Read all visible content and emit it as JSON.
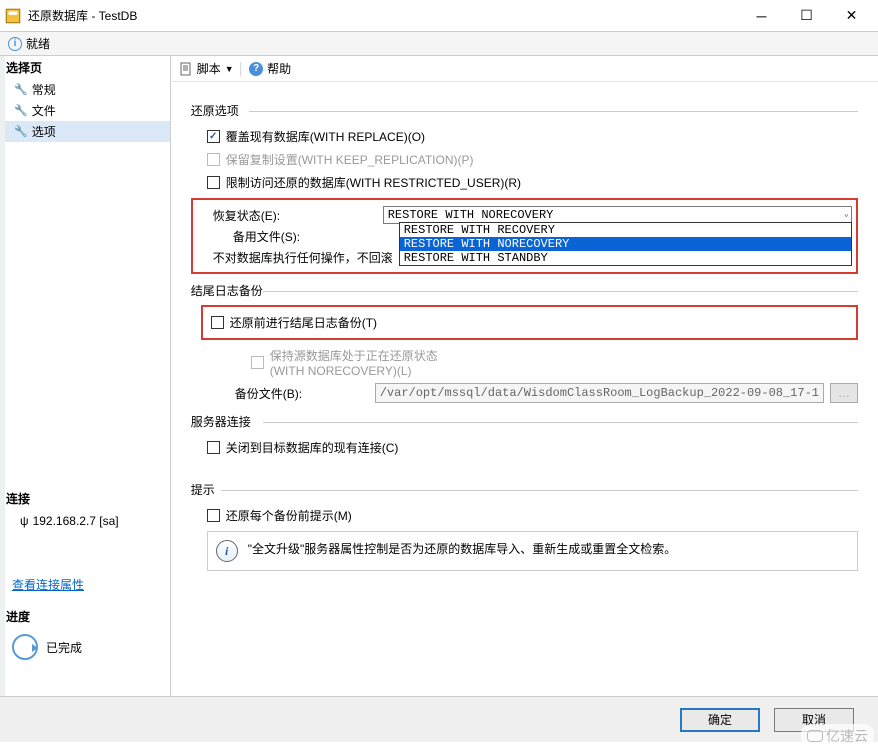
{
  "window": {
    "title": "还原数据库 - TestDB",
    "status": "就绪"
  },
  "sidebar": {
    "select_page_header": "选择页",
    "items": [
      {
        "label": "常规"
      },
      {
        "label": "文件"
      },
      {
        "label": "选项"
      }
    ],
    "connection_header": "连接",
    "connection_value": "192.168.2.7 [sa]",
    "view_link": "查看连接属性",
    "progress_header": "进度",
    "progress_status": "已完成"
  },
  "toolbar": {
    "script": "脚本",
    "help": "帮助"
  },
  "restore_options": {
    "title": "还原选项",
    "overwrite": "覆盖现有数据库(WITH REPLACE)(O)",
    "keep_replication": "保留复制设置(WITH KEEP_REPLICATION)(P)",
    "restricted_user": "限制访问还原的数据库(WITH RESTRICTED_USER)(R)",
    "recovery_state_label": "恢复状态(E):",
    "standby_file_label": "备用文件(S):",
    "recovery_selected": "RESTORE WITH NORECOVERY",
    "recovery_options": [
      "RESTORE WITH RECOVERY",
      "RESTORE WITH NORECOVERY",
      "RESTORE WITH STANDBY"
    ],
    "note_prefix": "不对数据库执行任何操作，不回滚"
  },
  "tail_log": {
    "title": "结尾日志备份",
    "take_backup": "还原前进行结尾日志备份(T)",
    "leave_norecovery": "保持源数据库处于正在还原状态",
    "leave_norecovery2": "(WITH NORECOVERY)(L)",
    "backup_file_label": "备份文件(B):",
    "backup_file_value": "/var/opt/mssql/data/WisdomClassRoom_LogBackup_2022-09-08_17-1"
  },
  "server_conn": {
    "title": "服务器连接",
    "close_existing": "关闭到目标数据库的现有连接(C)"
  },
  "hint": {
    "title": "提示",
    "prompt_before": "还原每个备份前提示(M)",
    "fulltext": "\"全文升级\"服务器属性控制是否为还原的数据库导入、重新生成或重置全文检索。"
  },
  "footer": {
    "ok": "确定",
    "cancel": "取消"
  },
  "watermark": "亿速云"
}
